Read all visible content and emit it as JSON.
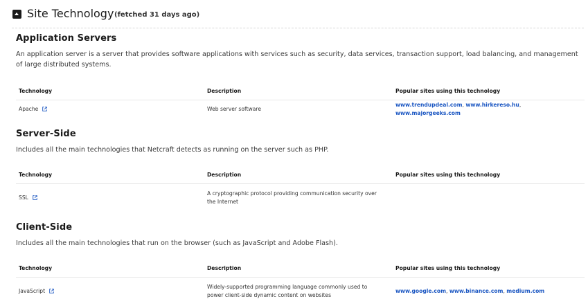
{
  "header": {
    "title": "Site Technology",
    "fetched": "(fetched 31 days ago)"
  },
  "table_headers": {
    "technology": "Technology",
    "description": "Description",
    "popular": "Popular sites using this technology"
  },
  "sections": [
    {
      "title": "Application Servers",
      "description": "An application server is a server that provides software applications with services such as security, data services, transaction support, load balancing, and management of large distributed systems.",
      "rows": [
        {
          "technology": "Apache",
          "description": "Web server software",
          "sites": [
            "www.trendupdeal.com",
            "www.hirkereso.hu",
            "www.majorgeeks.com"
          ]
        }
      ]
    },
    {
      "title": "Server-Side",
      "description": "Includes all the main technologies that Netcraft detects as running on the server such as PHP.",
      "rows": [
        {
          "technology": "SSL",
          "description": "A cryptographic protocol providing communication security over the Internet",
          "sites": []
        }
      ]
    },
    {
      "title": "Client-Side",
      "description": "Includes all the main technologies that run on the browser (such as JavaScript and Adobe Flash).",
      "rows": [
        {
          "technology": "JavaScript",
          "description": "Widely-supported programming language commonly used to power client-side dynamic content on websites",
          "sites": [
            "www.google.com",
            "www.binance.com",
            "medium.com"
          ]
        }
      ]
    }
  ],
  "colors": {
    "link": "#1a56c2",
    "heading": "#1a1a1a",
    "text": "#333333"
  }
}
